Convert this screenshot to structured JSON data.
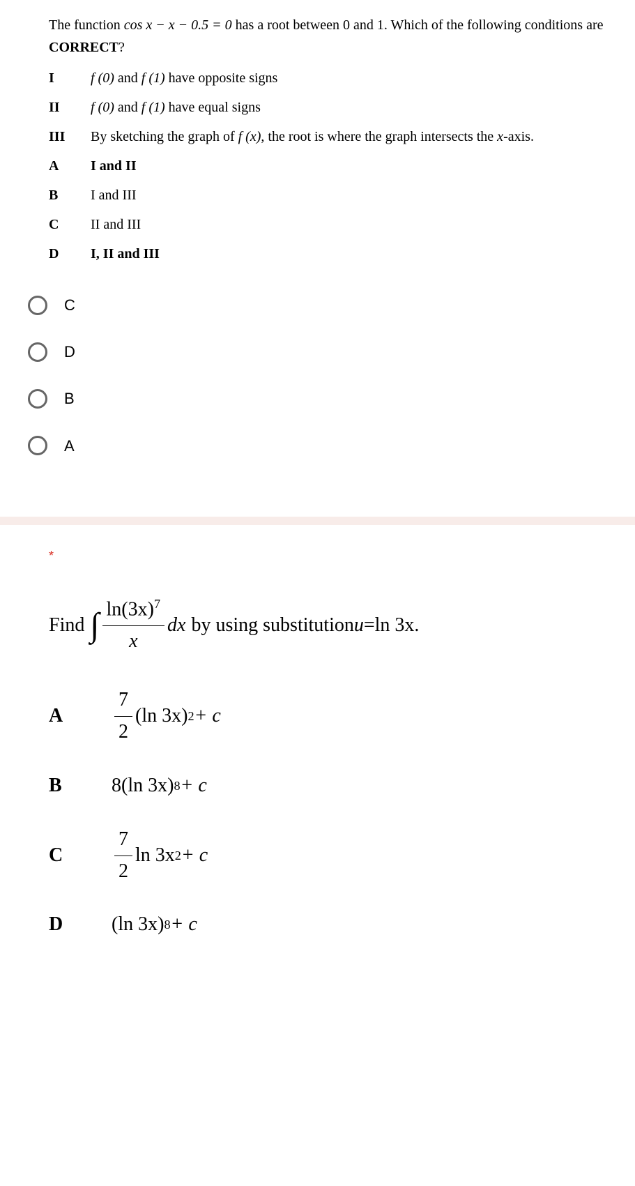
{
  "q1": {
    "intro_pre": "The function ",
    "intro_math": "cos x − x − 0.5 = 0",
    "intro_post": " has a root between 0 and 1. Which of the following conditions are ",
    "correct_word": "CORRECT",
    "question_mark": "?",
    "statements": [
      {
        "label": "I",
        "pre": "",
        "math1": "f (0)",
        "mid": " and ",
        "math2": "f (1)",
        "post": " have opposite signs"
      },
      {
        "label": "II",
        "pre": "",
        "math1": "f (0)",
        "mid": " and ",
        "math2": "f (1)",
        "post": " have equal signs"
      },
      {
        "label": "III",
        "pre": "By sketching the graph of ",
        "math1": "f (x)",
        "mid": ", the root is where the graph intersects the ",
        "math2": "x",
        "post": "-axis."
      }
    ],
    "choices": [
      {
        "label": "A",
        "text": "I and II"
      },
      {
        "label": "B",
        "text": "I and III"
      },
      {
        "label": "C",
        "text": "II and III"
      },
      {
        "label": "D",
        "text": "I, II and III"
      }
    ],
    "radio_options": [
      "C",
      "D",
      "B",
      "A"
    ]
  },
  "q2": {
    "required": "*",
    "find_word": "Find",
    "integral_num_base": "ln(3x)",
    "integral_num_exp": "7",
    "integral_den": "x",
    "dx": "dx",
    "by_using": " by using substitution ",
    "sub_lhs": "u",
    "sub_eq": " = ",
    "sub_rhs": "ln 3x.",
    "options": {
      "A": {
        "frac_num": "7",
        "frac_den": "2",
        "base": "(ln 3x)",
        "exp": "2",
        "tail": " + c"
      },
      "B": {
        "coef": "8",
        "base": "(ln 3x)",
        "exp": "8",
        "tail": " + c"
      },
      "C": {
        "frac_num": "7",
        "frac_den": "2",
        "mid": " ln 3x",
        "exp": "2",
        "tail": " + c"
      },
      "D": {
        "base": "(ln 3x)",
        "exp": "8",
        "tail": " + c"
      }
    },
    "labels": {
      "A": "A",
      "B": "B",
      "C": "C",
      "D": "D"
    }
  }
}
